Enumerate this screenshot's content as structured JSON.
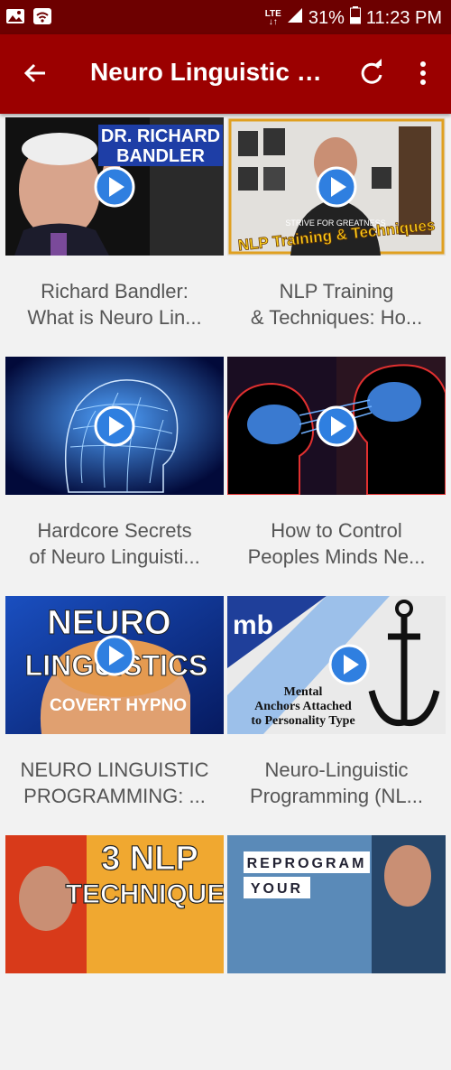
{
  "status": {
    "network": "LTE",
    "battery": "31%",
    "time": "11:23 PM"
  },
  "app_bar": {
    "title": "Neuro Linguistic Pr..."
  },
  "videos": [
    {
      "title_line1": "Richard Bandler:",
      "title_line2": "What is Neuro Lin...",
      "overlay1": "DR. RICHARD",
      "overlay2": "BANDLER"
    },
    {
      "title_line1": "NLP Training",
      "title_line2": "& Techniques: Ho...",
      "overlay1": "NLP Training & Techniques",
      "overlay2": "STRIVE FOR GREATNESS"
    },
    {
      "title_line1": "Hardcore Secrets",
      "title_line2": "of Neuro Linguisti..."
    },
    {
      "title_line1": "How to Control",
      "title_line2": "Peoples Minds Ne..."
    },
    {
      "title_line1": "NEURO LINGUISTIC",
      "title_line2": "PROGRAMMING:  ...",
      "overlay1": "NEURO",
      "overlay2": "LINGUISTICS",
      "overlay3": "COVERT HYPNO"
    },
    {
      "title_line1": "Neuro-Linguistic",
      "title_line2": "Programming (NL...",
      "overlay1": "mb",
      "overlay2": "Mental",
      "overlay3": "Anchors Attached",
      "overlay4": "to Personality Type"
    },
    {
      "overlay1": "3 NLP",
      "overlay2": "TECHNIQUES"
    },
    {
      "overlay1": "REPROGRAM",
      "overlay2": "YOUR"
    }
  ]
}
